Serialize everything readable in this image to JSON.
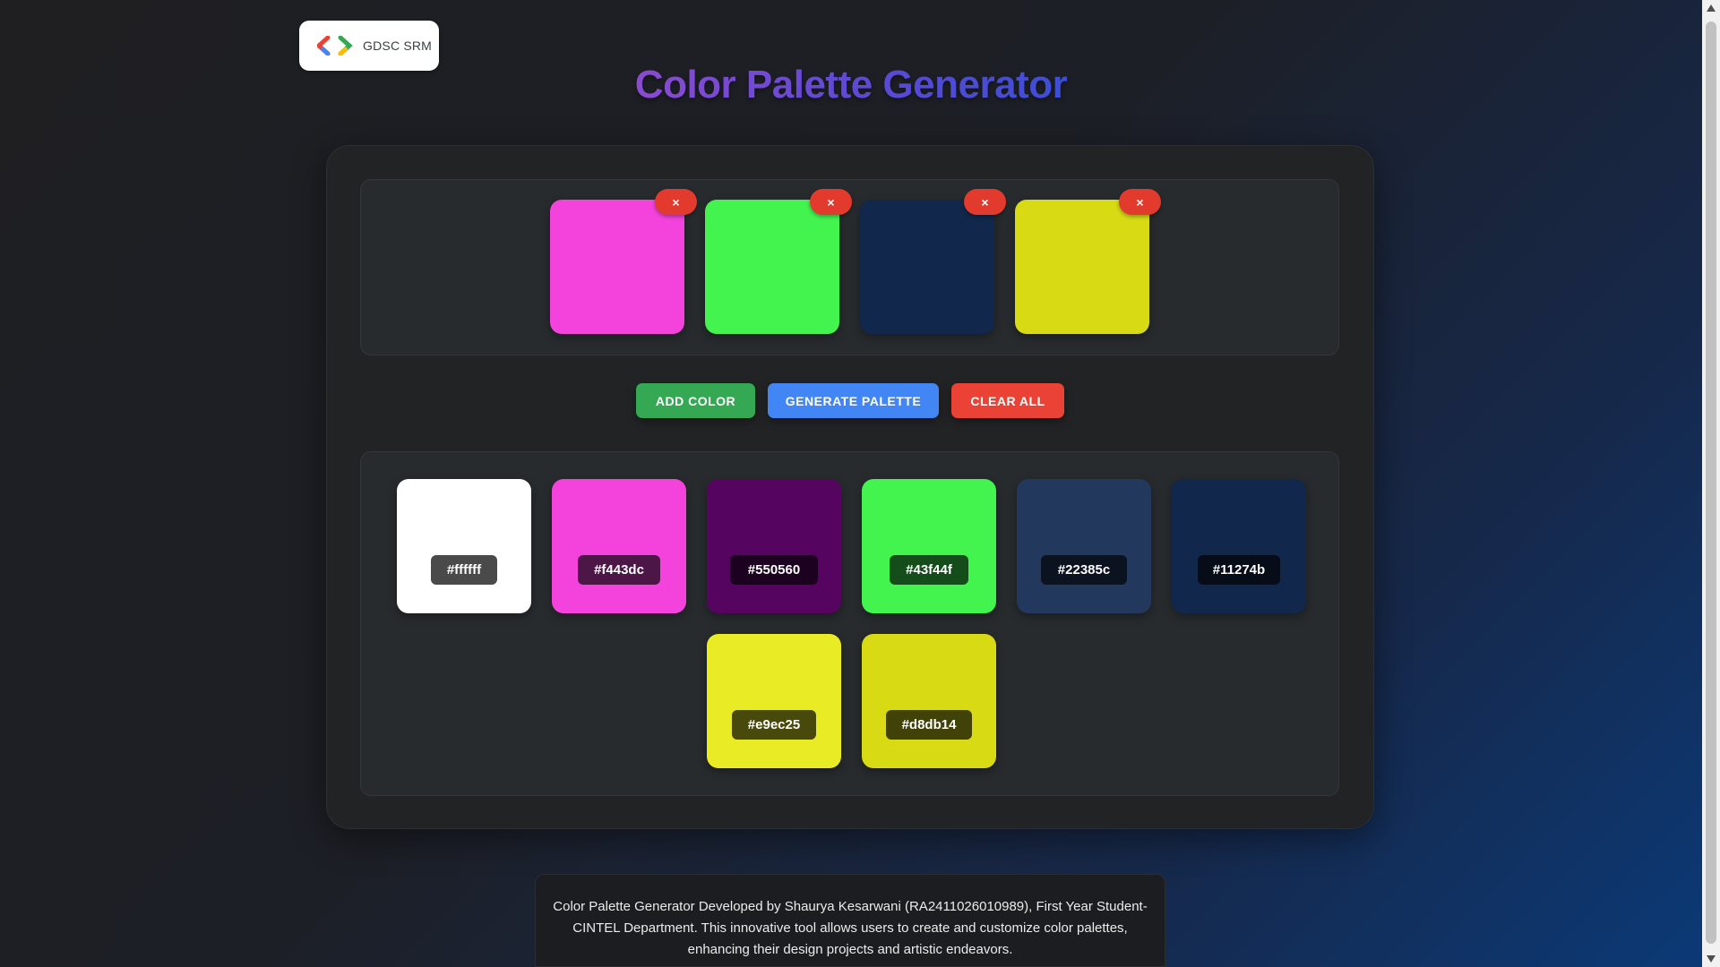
{
  "logo": {
    "text": "GDSC SRM"
  },
  "title": "Color Palette Generator",
  "selected_colors": [
    {
      "color": "#f443dc",
      "remove_label": "×"
    },
    {
      "color": "#43f44f",
      "remove_label": "×"
    },
    {
      "color": "#11274b",
      "remove_label": "×"
    },
    {
      "color": "#d8db14",
      "remove_label": "×"
    }
  ],
  "buttons": {
    "add": "ADD COLOR",
    "generate": "GENERATE PALETTE",
    "clear": "CLEAR ALL"
  },
  "palette": [
    {
      "hex": "#ffffff"
    },
    {
      "hex": "#f443dc"
    },
    {
      "hex": "#550560"
    },
    {
      "hex": "#43f44f"
    },
    {
      "hex": "#22385c"
    },
    {
      "hex": "#11274b"
    },
    {
      "hex": "#e9ec25"
    },
    {
      "hex": "#d8db14"
    }
  ],
  "footer": {
    "text": "Color Palette Generator Developed by Shaurya Kesarwani (RA2411026010989), First Year Student- CINTEL Department. This innovative tool allows users to create and customize color palettes, enhancing their design projects and artistic endeavors."
  },
  "colors": {
    "add_button": "#34a853",
    "generate_button": "#4285f4",
    "clear_button": "#ea4335",
    "remove_badge": "#e23b2d"
  }
}
